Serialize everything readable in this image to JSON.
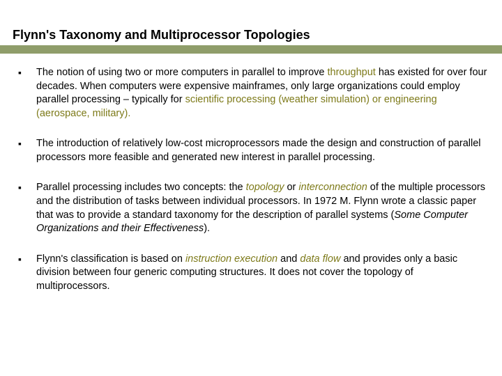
{
  "title": "Flynn's Taxonomy and Multiprocessor Topologies",
  "b1": {
    "t1": "The notion of using two or more computers in parallel to improve ",
    "throughput": "throughput",
    "t2": " has existed for over four decades.  When computers were expensive mainframes, only large organizations could employ parallel processing – typically for ",
    "sci": "scientific processing (weather simulation) or engineering (aerospace, military)."
  },
  "b2": "The introduction of relatively low-cost microprocessors made the design and construction of parallel processors more feasible and generated new interest in parallel processing.",
  "b3": {
    "t1": "Parallel processing includes two concepts: the ",
    "topo": "topology",
    "t2": " or ",
    "inter": "interconnection",
    "t3": " of the multiple processors and the distribution of tasks between individual processors. In 1972 M. Flynn wrote a classic paper that was to provide a standard taxonomy for the description of parallel systems (",
    "paper": "Some Computer Organizations and their Effectiveness",
    "t4": ")."
  },
  "b4": {
    "t1": "Flynn's classification is based on  ",
    "ie": "instruction execution",
    "t2": " and ",
    "df": "data flow",
    "t3": " and provides only a basic division between four generic computing structures. It does not cover the topology of multiprocessors."
  }
}
